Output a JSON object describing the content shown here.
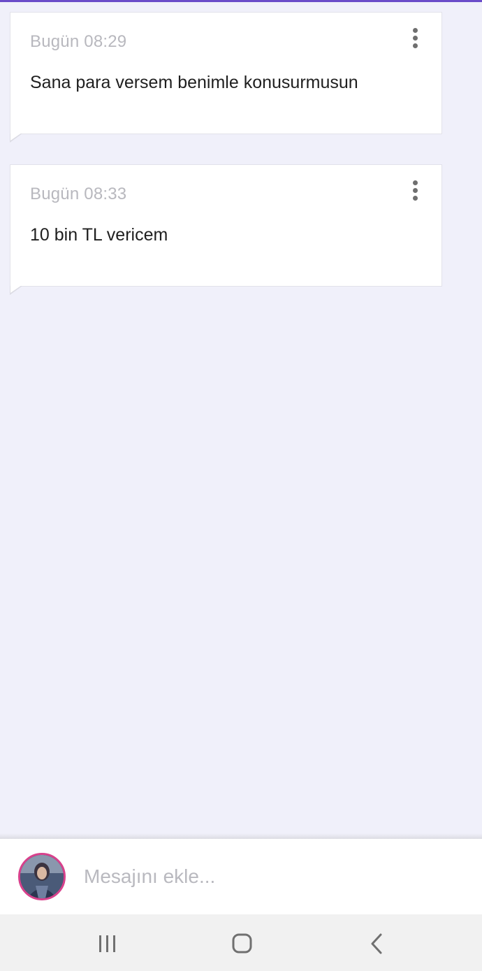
{
  "messages": [
    {
      "time": "Bugün 08:29",
      "text": "Sana para versem benimle konusurmusun"
    },
    {
      "time": "Bugün 08:33",
      "text": "10 bin TL vericem"
    }
  ],
  "composer": {
    "placeholder": "Mesajını ekle..."
  },
  "icons": {
    "more": "more-vertical-icon",
    "recent_apps": "recent-apps-icon",
    "home": "home-icon",
    "back": "back-icon"
  },
  "colors": {
    "accent": "#6a4cc9",
    "background": "#f0f0fa",
    "avatar_ring": "#d8418c"
  }
}
